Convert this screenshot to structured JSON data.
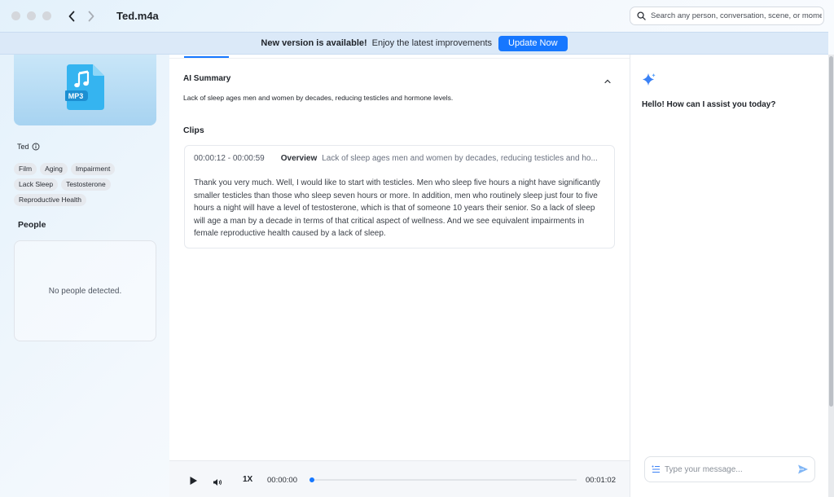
{
  "window": {
    "title": "Ted.m4a",
    "search_placeholder": "Search any person, conversation, scene, or moment"
  },
  "banner": {
    "headline": "New version is available!",
    "subtext": "Enjoy the latest improvements",
    "button_label": "Update Now"
  },
  "sidebar": {
    "file_badge": "MP3",
    "speaker": "Ted",
    "tags": [
      "Film",
      "Aging",
      "Impairment",
      "Lack Sleep",
      "Testosterone",
      "Reproductive Health"
    ],
    "people_title": "People",
    "people_empty": "No people detected."
  },
  "main": {
    "summary_title": "AI Summary",
    "summary_text": "Lack of sleep ages men and women by decades, reducing testicles and hormone levels.",
    "clips_title": "Clips",
    "clip": {
      "time_range": "00:00:12 - 00:00:59",
      "label": "Overview",
      "description": "Lack of sleep ages men and women by decades, reducing testicles and ho...",
      "transcript": "Thank you very much. Well, I would like to start with testicles. Men who sleep five hours a night have significantly smaller testicles than those who sleep seven hours or more. In addition, men who routinely sleep just four to five hours a night will have a level of testosterone, which is that of someone 10 years their senior. So a lack of sleep will age a man by a decade in terms of that critical aspect of wellness. And we see equivalent impairments in female reproductive health caused by a lack of sleep."
    }
  },
  "player": {
    "speed": "1X",
    "current_time": "00:00:00",
    "duration": "00:01:02",
    "progress_fraction": 0.0
  },
  "assistant": {
    "greeting": "Hello! How can I assist you today?",
    "input_placeholder": "Type your message..."
  },
  "colors": {
    "accent": "#1677ff",
    "banner_bg": "#dbe9f8"
  },
  "icons": {
    "back": "chevron-left-icon",
    "forward": "chevron-right-icon",
    "search": "search-icon",
    "file": "music-file-icon",
    "info": "info-icon",
    "collapse": "chevron-up-icon",
    "play": "play-icon",
    "volume": "volume-icon",
    "sparkle": "sparkle-icon",
    "list": "list-icon",
    "send": "send-icon"
  }
}
